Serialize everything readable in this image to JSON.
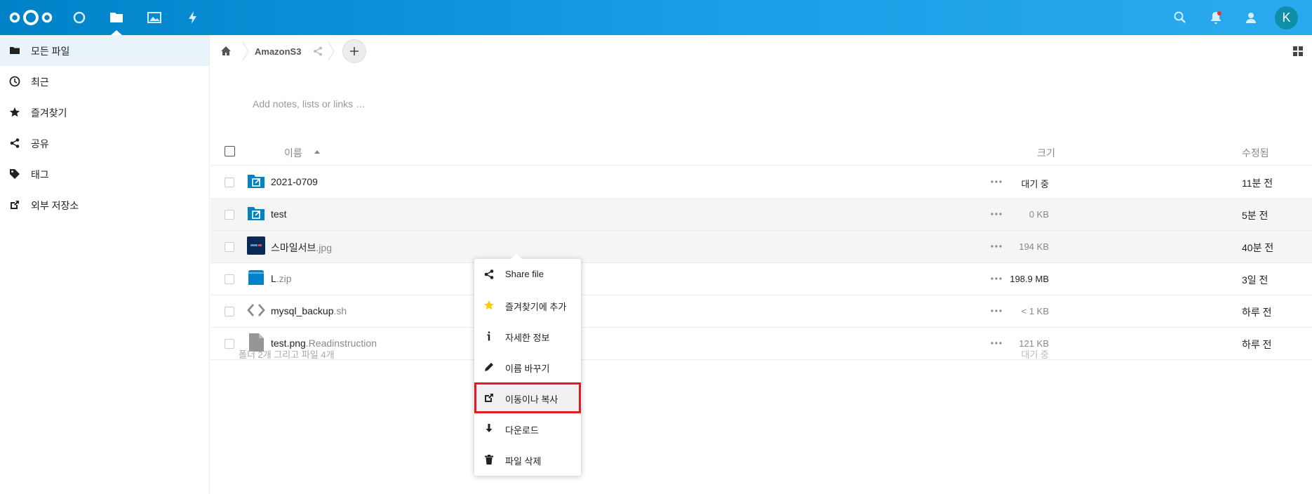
{
  "header": {
    "apps": [
      "logo",
      "dashboard-icon",
      "files-icon",
      "photos-icon",
      "activity-icon"
    ],
    "right_icons": [
      "search-icon",
      "notifications-icon",
      "contacts-icon"
    ],
    "avatar_letter": "K"
  },
  "sidebar": {
    "items": [
      {
        "label": "모든 파일",
        "icon": "folder-icon"
      },
      {
        "label": "최근",
        "icon": "clock-icon"
      },
      {
        "label": "즐겨찾기",
        "icon": "star-icon"
      },
      {
        "label": "공유",
        "icon": "share-icon"
      },
      {
        "label": "태그",
        "icon": "tag-icon"
      },
      {
        "label": "외부 저장소",
        "icon": "external-link-icon"
      }
    ]
  },
  "breadcrumb": {
    "folder": "AmazonS3"
  },
  "notes_placeholder": "Add notes, lists or links …",
  "table": {
    "headers": {
      "name": "이름",
      "size": "크기",
      "modified": "수정됨"
    },
    "rows": [
      {
        "base": "2021-0709",
        "ext": "",
        "icon": "shared-folder-icon",
        "size": "대기 중",
        "modified": "11분 전"
      },
      {
        "base": "test",
        "ext": "",
        "icon": "shared-folder-icon",
        "size": "0 KB",
        "modified": "5분 전"
      },
      {
        "base": "스마일서브",
        "ext": ".jpg",
        "icon": "image-thumbnail-icon",
        "size": "194 KB",
        "modified": "40분 전"
      },
      {
        "base": "L",
        "ext": ".zip",
        "icon": "archive-icon",
        "size": "198.9 MB",
        "modified": "3일 전"
      },
      {
        "base": "mysql_backup",
        "ext": ".sh",
        "icon": "code-file-icon",
        "size": "< 1 KB",
        "modified": "하루 전"
      },
      {
        "base": "test.png",
        "ext": ".Readinstruction",
        "icon": "generic-file-icon",
        "size": "121 KB",
        "modified": "하루 전"
      }
    ],
    "summary": "폴더 2개 그리고 파일 4개",
    "summary_size": "대기 중"
  },
  "context_menu": {
    "items": [
      {
        "label": "Share file",
        "icon": "share-icon"
      },
      {
        "label": "즐겨찾기에 추가",
        "icon": "star-icon"
      },
      {
        "label": "자세한 정보",
        "icon": "info-icon"
      },
      {
        "label": "이름 바꾸기",
        "icon": "pencil-icon"
      },
      {
        "label": "이동이나 복사",
        "icon": "move-copy-icon"
      },
      {
        "label": "다운로드",
        "icon": "download-icon"
      },
      {
        "label": "파일 삭제",
        "icon": "trash-icon"
      }
    ]
  },
  "colors": {
    "header": "#0082c9",
    "accent": "#0082c9",
    "highlight": "#e01b24",
    "star": "#fc0"
  }
}
